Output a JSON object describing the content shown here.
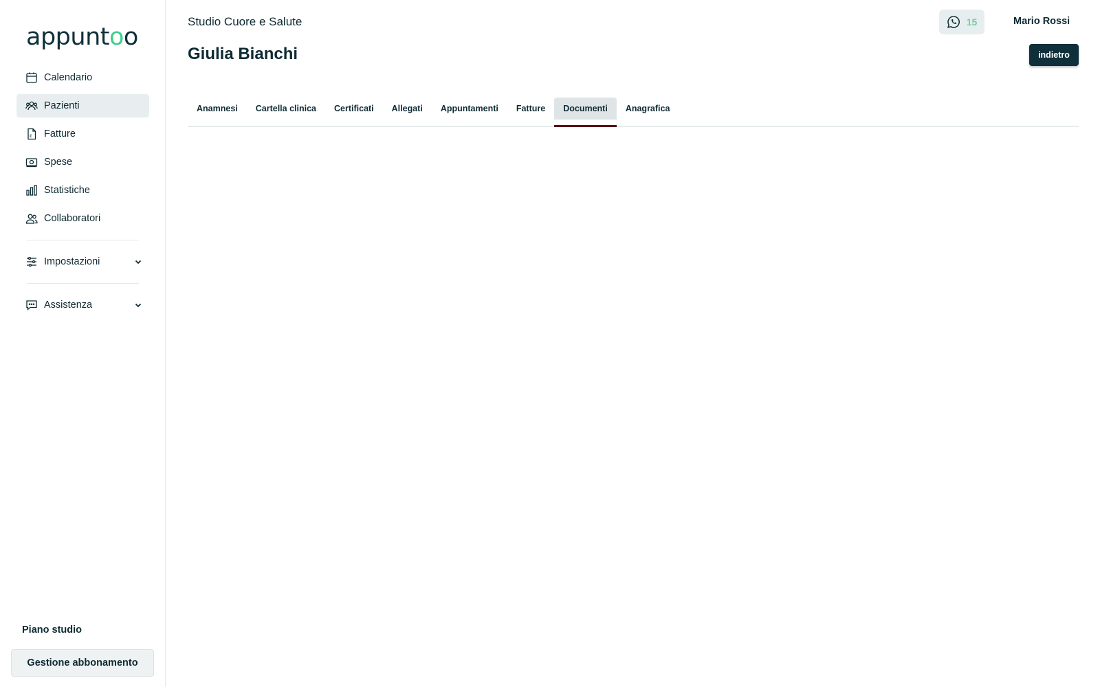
{
  "app": {
    "logo_text": "appuntoo"
  },
  "sidebar": {
    "items": [
      {
        "label": "Calendario",
        "icon": "calendar-icon"
      },
      {
        "label": "Pazienti",
        "icon": "users-icon",
        "active": true
      },
      {
        "label": "Fatture",
        "icon": "invoice-icon"
      },
      {
        "label": "Spese",
        "icon": "money-icon"
      },
      {
        "label": "Statistiche",
        "icon": "chart-icon"
      },
      {
        "label": "Collaboratori",
        "icon": "collaborators-icon"
      }
    ],
    "settings_label": "Impostazioni",
    "support_label": "Assistenza",
    "plan_label": "Piano studio",
    "plan_button": "Gestione abbonamento"
  },
  "header": {
    "studio_name": "Studio Cuore e Salute",
    "patient_name": "Giulia Bianchi",
    "whatsapp_count": "15",
    "user_name": "Mario Rossi",
    "back_button": "indietro"
  },
  "tabs": [
    {
      "label": "Anamnesi"
    },
    {
      "label": "Cartella clinica"
    },
    {
      "label": "Certificati"
    },
    {
      "label": "Allegati"
    },
    {
      "label": "Appuntamenti"
    },
    {
      "label": "Fatture"
    },
    {
      "label": "Documenti",
      "active": true
    },
    {
      "label": "Anagrafica"
    }
  ],
  "colors": {
    "primary": "#0f2f3a",
    "accent": "#3ecf8e",
    "active_tab_underline": "#5a0d14"
  }
}
